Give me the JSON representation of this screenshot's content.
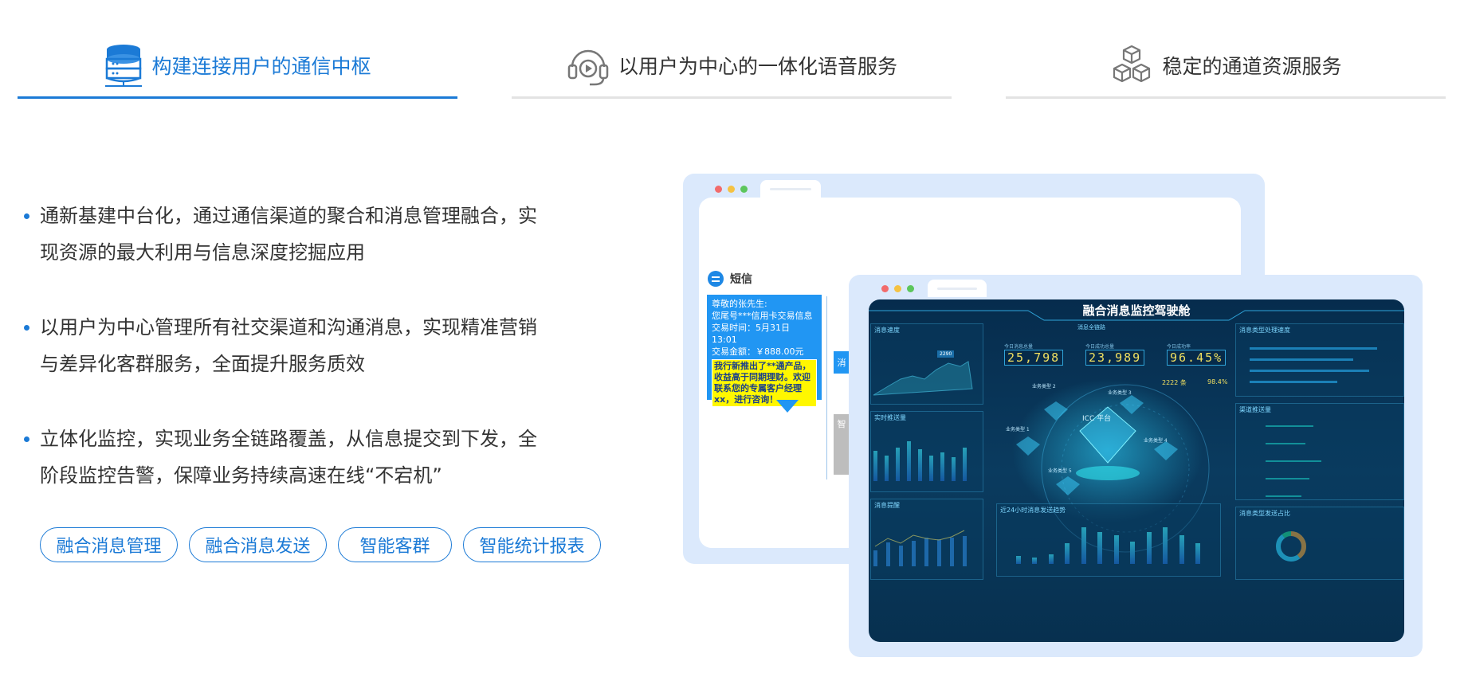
{
  "tabs": [
    {
      "label": "构建连接用户的通信中枢",
      "icon": "database-icon",
      "active": true
    },
    {
      "label": "以用户为中心的一体化语音服务",
      "icon": "headset-icon",
      "active": false
    },
    {
      "label": "稳定的通道资源服务",
      "icon": "cubes-icon",
      "active": false
    }
  ],
  "bullets": [
    {
      "line1": "通新基建中台化，通过通信渠道的聚合和消息管理融合，实",
      "line2": "现资源的最大利用与信息深度挖掘应用"
    },
    {
      "line1": "以用户为中心管理所有社交渠道和沟通消息，实现精准营销",
      "line2": "与差异化客群服务，全面提升服务质效"
    },
    {
      "line1": "立体化监控，实现业务全链路覆盖，从信息提交到下发，全",
      "line2": "阶段监控告警，保障业务持续高速在线“不宕机”"
    }
  ],
  "chips": [
    "融合消息管理",
    "融合消息发送",
    "智能客群",
    "智能统计报表"
  ],
  "illustration": {
    "sms": {
      "title": "短信",
      "line1": "尊敬的张先生:",
      "line2": "您尾号***信用卡交易信息",
      "line3": "交易时间：5月31日 13:01",
      "line4": "交易金额：￥888.00元",
      "highlight": "我行新推出了**通产品，收益高于同期理财。欢迎联系您的专属客户经理xx，进行咨询！"
    },
    "mini_box1": "消",
    "mini_box2": "智",
    "dashboard": {
      "title": "融合消息监控驾驶舱",
      "kpis": [
        {
          "label": "今日消息总量",
          "value": "25,798"
        },
        {
          "label": "今日成功总量",
          "value": "23,989"
        },
        {
          "label": "今日成功率",
          "value": "96.45%"
        }
      ],
      "panels": {
        "top_left": "消息速度",
        "mid_left": "实时推送量",
        "bottom_left": "消息提醒",
        "center_title": "消息全链路",
        "bottom_center": "近24小时消息发送趋势",
        "top_right": "消息类型处理速度",
        "mid_right": "渠道推送量",
        "bottom_right": "消息类型发送占比"
      },
      "center_labels": [
        "业务类型 1",
        "业务类型 2",
        "业务类型 3",
        "业务类型 4",
        "业务类型 5"
      ],
      "icc_label": "ICC 平台",
      "send_stats": {
        "count": "2222 条",
        "rate": "98.4%"
      },
      "area_tooltip": "2290"
    }
  },
  "colors": {
    "accent": "#1b7ad6",
    "tab_underline": "#e3e3e3",
    "frame_bg": "#dbe9fc"
  }
}
